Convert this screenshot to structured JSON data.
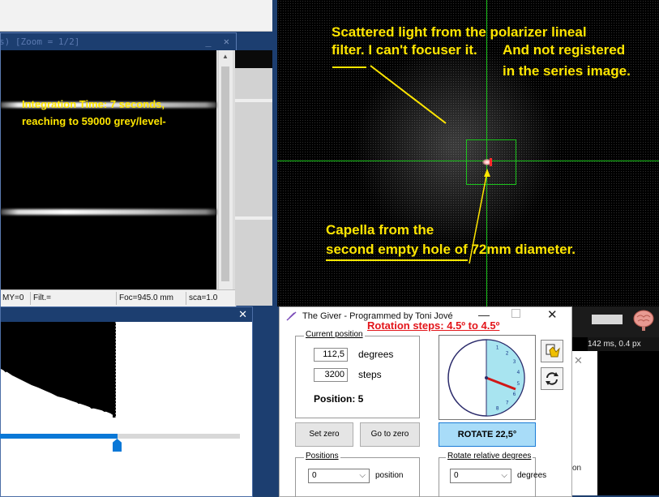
{
  "image_window": {
    "title": "s)  [Zoom = 1/2]",
    "window_buttons": "_ ✕",
    "annotation_line1": "Integration Time: 7 seconds,",
    "annotation_line2": "reaching to 59000 grey/level-",
    "status_my": "MY=0",
    "status_filt": "Filt.=",
    "status_foc": "Foc=945.0 mm",
    "status_sca": "sca=1.0"
  },
  "histogram_window": {
    "close": "✕",
    "slider_fraction": 0.49
  },
  "scope_view": {
    "annot_scatter_line1": "Scattered light from the polarizer lineal",
    "annot_scatter_line2": "filter.  I can't focuser it.",
    "annot_scatter_line3": "And not registered",
    "annot_scatter_line4": "in the series image.",
    "annot_capella_line1": "Capella  from the",
    "annot_capella_line2": "second empty  hole  of 72mm diameter.",
    "crosshair_color": "#1cc41c",
    "annotation_color": "#ffe600"
  },
  "right_panel": {
    "status_text": "142 ms, 0.4 px",
    "close": "✕",
    "partial_label": "on"
  },
  "giver": {
    "title": "The Giver - Programmed by Toni Jové",
    "minimize": "—",
    "close": "✕",
    "rotation_label": "Rotation steps: 4.5º to 4.5º",
    "current_position_group": "Current position",
    "degrees_value": "112,5",
    "degrees_label": "degrees",
    "steps_value": "3200",
    "steps_label": "steps",
    "position_text": "Position: 5",
    "set_zero_label": "Set zero",
    "go_to_zero_label": "Go to zero",
    "rotate_label": "ROTATE 22,5°",
    "positions_group": "Positions",
    "positions_value": "0",
    "position_label": "position",
    "rotate_rel_group": "Rotate relative degrees",
    "rotate_rel_value": "0",
    "rotate_rel_unit": "degrees",
    "dial_labels": [
      "1",
      "2",
      "3",
      "4",
      "5",
      "6",
      "7",
      "8"
    ],
    "dial_angle_degrees": 112.5
  }
}
